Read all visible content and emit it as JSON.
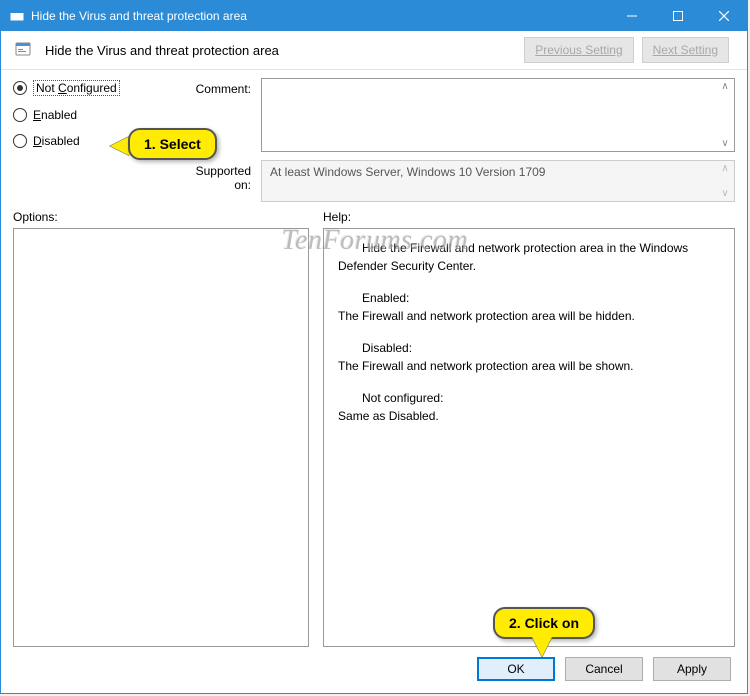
{
  "titlebar": {
    "title": "Hide the Virus and threat protection area"
  },
  "header": {
    "policy_title": "Hide the Virus and threat protection area",
    "prev_button": "Previous Setting",
    "next_button": "Next Setting"
  },
  "radios": {
    "not_configured": "Not Configured",
    "enabled": "Enabled",
    "disabled": "Disabled"
  },
  "labels": {
    "comment": "Comment:",
    "supported": "Supported on:",
    "options": "Options:",
    "help": "Help:"
  },
  "supported_text": "At least Windows Server, Windows 10 Version 1709",
  "help": {
    "intro": "Hide the Firewall and network protection area in the Windows Defender Security Center.",
    "enabled_title": "Enabled:",
    "enabled_body": "The Firewall and network protection area will be hidden.",
    "disabled_title": "Disabled:",
    "disabled_body": "The Firewall and network protection area will be shown.",
    "notconf_title": "Not configured:",
    "notconf_body": "Same as Disabled."
  },
  "footer": {
    "ok": "OK",
    "cancel": "Cancel",
    "apply": "Apply"
  },
  "annotations": {
    "step1": "1. Select",
    "step2": "2. Click on"
  },
  "watermark": "TenForums.com"
}
